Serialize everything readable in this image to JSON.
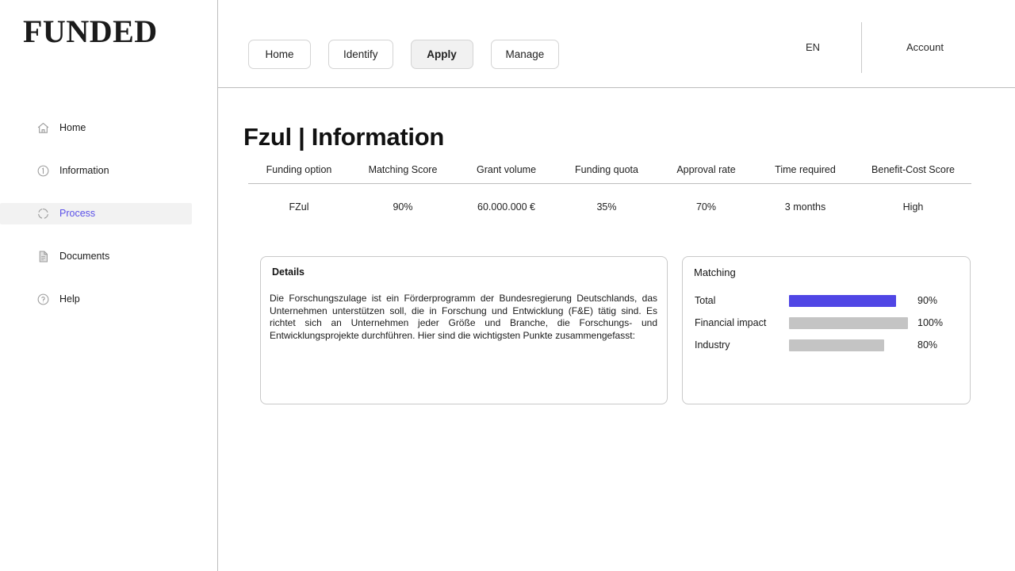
{
  "brand": {
    "logo": "FUNDED"
  },
  "sidebar": {
    "items": [
      {
        "label": "Home",
        "icon": "home-icon",
        "active": false
      },
      {
        "label": "Information",
        "icon": "info-circle-icon",
        "active": false
      },
      {
        "label": "Process",
        "icon": "process-circle-icon",
        "active": true
      },
      {
        "label": "Documents",
        "icon": "document-icon",
        "active": false
      },
      {
        "label": "Help",
        "icon": "question-circle-icon",
        "active": false
      }
    ]
  },
  "header": {
    "nav_buttons": [
      {
        "label": "Home",
        "active": false
      },
      {
        "label": "Identify",
        "active": false
      },
      {
        "label": "Apply",
        "active": true
      },
      {
        "label": "Manage",
        "active": false
      }
    ],
    "language": "EN",
    "account": "Account"
  },
  "main": {
    "page_title": "Fzul | Information",
    "table": {
      "headers": [
        "Funding option",
        "Matching Score",
        "Grant volume",
        "Funding quota",
        "Approval rate",
        "Time required",
        "Benefit-Cost Score"
      ],
      "rows": [
        [
          "FZul",
          "90%",
          "60.000.000 €",
          "35%",
          "70%",
          "3 months",
          "High"
        ]
      ]
    },
    "details_card": {
      "title": "Details",
      "body": "Die Forschungszulage ist ein Förderprogramm der Bundesregierung Deutschlands, das Unternehmen unterstützen soll, die in Forschung und Entwicklung (F&E) tätig sind. Es richtet sich an Unternehmen jeder Größe und Branche, die Forschungs- und Entwicklungsprojekte durchführen. Hier sind die wichtigsten Punkte zusammengefasst:"
    },
    "matching_card": {
      "title": "Matching",
      "rows": [
        {
          "label": "Total",
          "value": "90%",
          "percent": 90,
          "color": "#5046e5"
        },
        {
          "label": "Financial impact",
          "value": "100%",
          "percent": 100,
          "color": "#c4c4c4"
        },
        {
          "label": "Industry",
          "value": "80%",
          "percent": 80,
          "color": "#c4c4c4"
        }
      ],
      "bar_max_width": 150
    }
  },
  "colors": {
    "accent": "#5046e5",
    "active_link": "#5b51e8",
    "bar_muted": "#c4c4c4",
    "border": "#c9c9c9",
    "divider": "#bdbdbd",
    "active_bg": "#f1f1f1"
  }
}
